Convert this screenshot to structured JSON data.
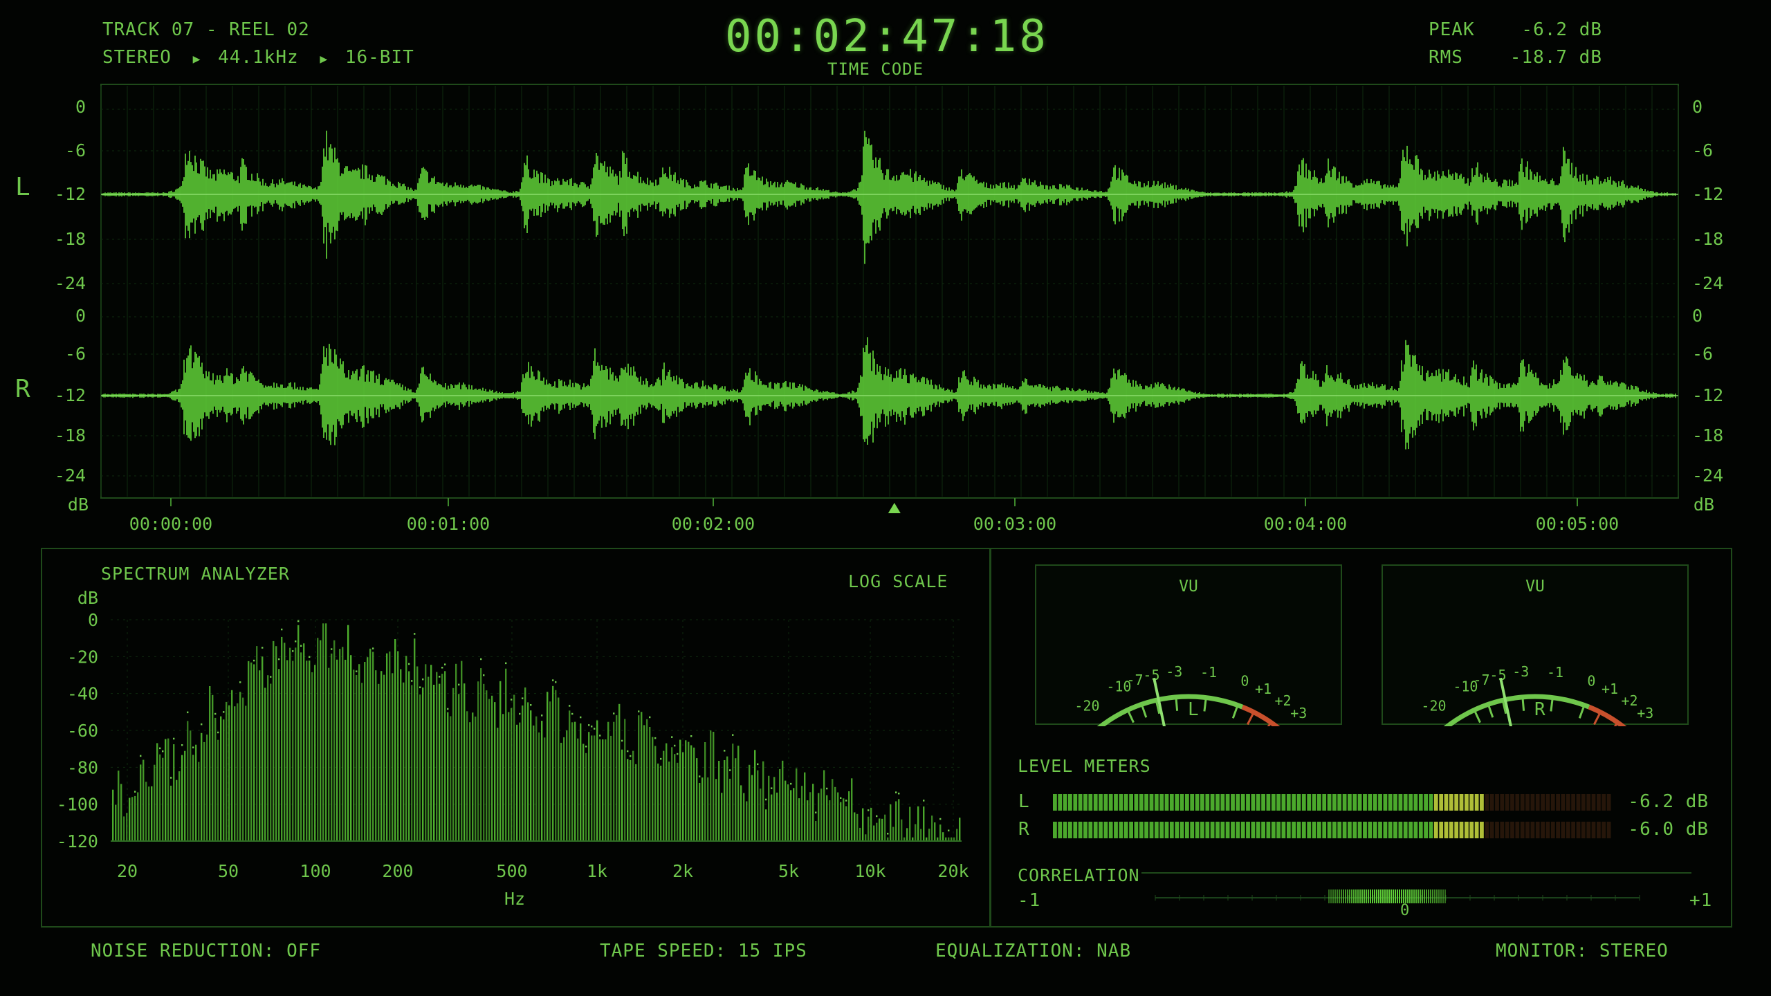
{
  "header": {
    "track": "TRACK 07 - REEL 02",
    "format": {
      "channels": "STEREO",
      "rate": "44.1kHz",
      "depth": "16-BIT"
    },
    "timecode": "00:02:47:18",
    "timecode_label": "TIME CODE",
    "peak": {
      "label": "PEAK",
      "value": "-6.2 dB"
    },
    "rms": {
      "label": "RMS",
      "value": "-18.7 dB"
    }
  },
  "waveform": {
    "channels": [
      "L",
      "R"
    ],
    "db_ticks": [
      "0",
      "-6",
      "-12",
      "-18",
      "-24"
    ],
    "db_unit": "dB",
    "time_labels": [
      "00:00:00",
      "00:01:00",
      "00:02:00",
      "00:03:00",
      "00:04:00",
      "00:05:00"
    ],
    "playhead_fraction": 0.503
  },
  "spectrum": {
    "title": "SPECTRUM ANALYZER",
    "scale": "LOG SCALE",
    "y_unit": "dB",
    "y_ticks": [
      "0",
      "-20",
      "-40",
      "-60",
      "-80",
      "-100",
      "-120"
    ],
    "x_ticks": [
      "20",
      "50",
      "100",
      "200",
      "500",
      "1k",
      "2k",
      "5k",
      "10k",
      "20k"
    ],
    "x_unit": "Hz"
  },
  "vu": {
    "title": "VU",
    "scale": [
      "-20",
      "-10",
      "-7",
      "-5",
      "-3",
      "-1",
      "0",
      "+1",
      "+2",
      "+3"
    ],
    "left": {
      "channel": "L"
    },
    "right": {
      "channel": "R"
    }
  },
  "levels": {
    "title": "LEVEL METERS",
    "left": {
      "channel": "L",
      "value": "-6.2 dB",
      "fill": 0.77
    },
    "right": {
      "channel": "R",
      "value": "-6.0 dB",
      "fill": 0.77
    }
  },
  "correlation": {
    "title": "CORRELATION",
    "min": "-1",
    "mid": "0",
    "max": "+1"
  },
  "footer": {
    "noise_reduction": "NOISE REDUCTION: OFF",
    "tape_speed": "TAPE SPEED: 15 IPS",
    "equalization": "EQUALIZATION: NAB",
    "monitor": "MONITOR: STEREO"
  },
  "colors": {
    "accent": "#79d650",
    "green_dim": "#3e8a2c",
    "warning": "#c8d040",
    "red": "#c8502c",
    "grid": "#143814"
  }
}
